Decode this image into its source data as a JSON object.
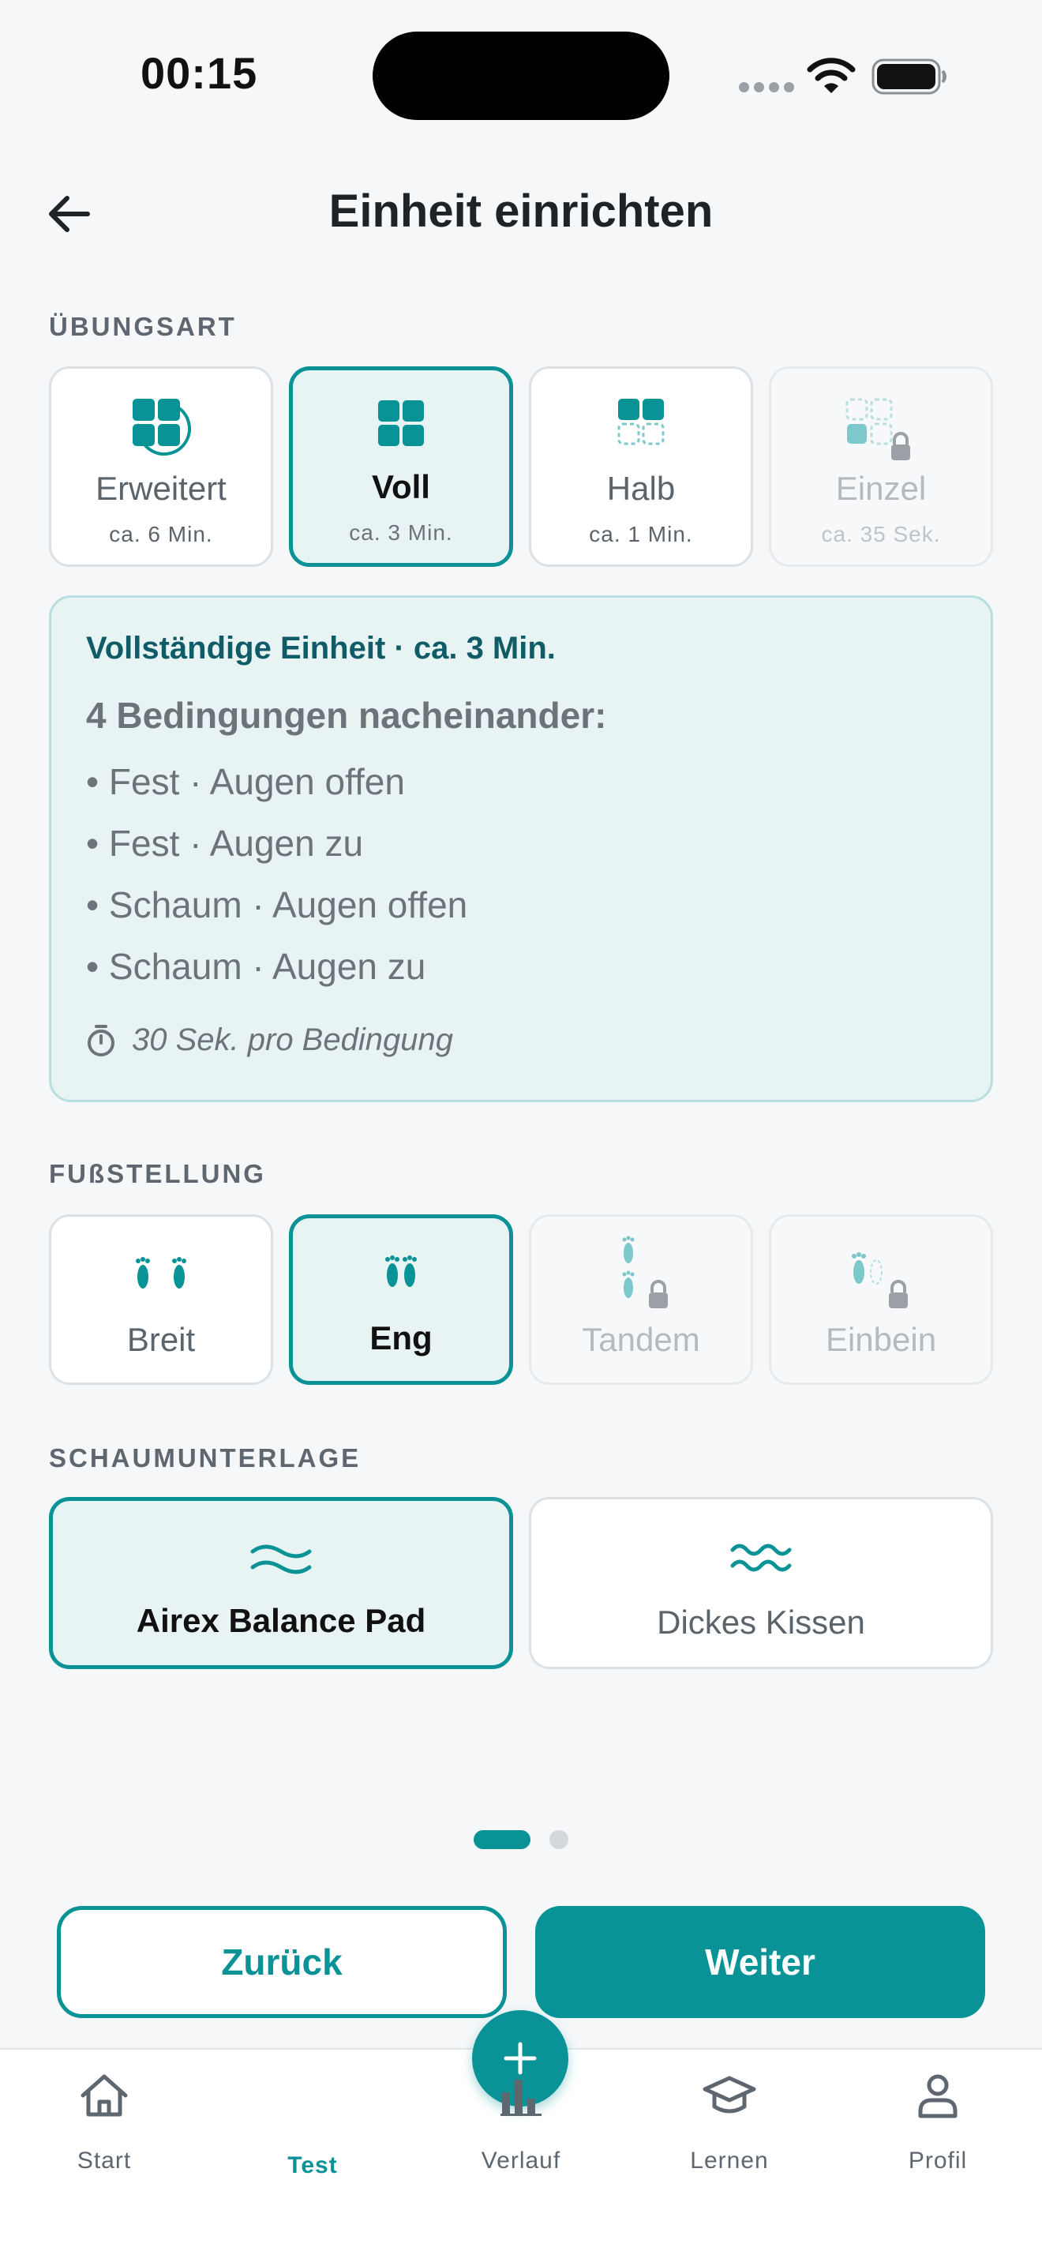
{
  "status_bar": {
    "time": "00:15"
  },
  "header": {
    "title": "Einheit einrichten"
  },
  "exercise_type": {
    "label": "ÜBUNGSART",
    "options": [
      {
        "title": "Erweitert",
        "duration": "ca. 6 Min.",
        "selected": false,
        "locked": false
      },
      {
        "title": "Voll",
        "duration": "ca. 3 Min.",
        "selected": true,
        "locked": false
      },
      {
        "title": "Halb",
        "duration": "ca. 1 Min.",
        "selected": false,
        "locked": false
      },
      {
        "title": "Einzel",
        "duration": "ca. 35 Sek.",
        "selected": false,
        "locked": true
      }
    ]
  },
  "info": {
    "heading": "Vollständige Einheit · ca. 3 Min.",
    "subheading": "4 Bedingungen nacheinander:",
    "items": [
      "• Fest · Augen offen",
      "• Fest · Augen zu",
      "• Schaum · Augen offen",
      "• Schaum · Augen zu"
    ],
    "timer_text": "30 Sek. pro Bedingung"
  },
  "foot_position": {
    "label": "FUßSTELLUNG",
    "options": [
      {
        "title": "Breit",
        "selected": false,
        "locked": false
      },
      {
        "title": "Eng",
        "selected": true,
        "locked": false
      },
      {
        "title": "Tandem",
        "selected": false,
        "locked": true
      },
      {
        "title": "Einbein",
        "selected": false,
        "locked": true
      }
    ]
  },
  "foam": {
    "label": "SCHAUMUNTERLAGE",
    "options": [
      {
        "title": "Airex Balance Pad",
        "selected": true
      },
      {
        "title": "Dickes Kissen",
        "selected": false
      }
    ]
  },
  "pager": {
    "current": 1,
    "total": 2
  },
  "buttons": {
    "back": "Zurück",
    "next": "Weiter"
  },
  "tabbar": {
    "tabs": [
      {
        "label": "Start",
        "icon": "home-icon"
      },
      {
        "label": "Test",
        "icon": "plus-icon",
        "active": true
      },
      {
        "label": "Verlauf",
        "icon": "bar-chart-icon"
      },
      {
        "label": "Lernen",
        "icon": "graduation-cap-icon"
      },
      {
        "label": "Profil",
        "icon": "person-icon"
      }
    ]
  },
  "colors": {
    "accent": "#0A9396",
    "selected_bg": "#E8F3F4",
    "background": "#F5F7F9"
  }
}
